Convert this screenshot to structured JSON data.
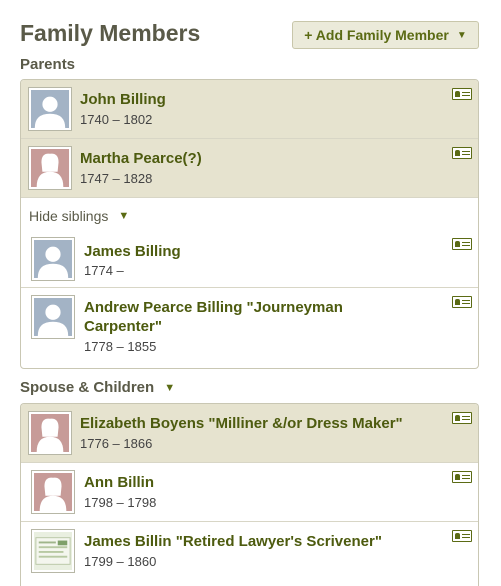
{
  "header": {
    "title": "Family Members",
    "add_button_label": "+ Add Family Member",
    "add_button_caret": "▼"
  },
  "parents_section": {
    "label": "Parents"
  },
  "parents": [
    {
      "name": "John Billing",
      "dates": "1740 – 1802",
      "avatar": "male-silhouette-icon"
    },
    {
      "name": "Martha Pearce(?)",
      "dates": "1747 – 1828",
      "avatar": "female-silhouette-icon"
    }
  ],
  "siblings_toggle": {
    "label": "Hide siblings",
    "caret": "▼"
  },
  "siblings": [
    {
      "name": "James Billing",
      "dates": "1774 –",
      "avatar": "male-silhouette-icon"
    },
    {
      "name_line1": "Andrew Pearce Billing \"Journeyman",
      "name_line2": "Carpenter\"",
      "dates": "1778 – 1855",
      "avatar": "male-silhouette-icon"
    }
  ],
  "spouse_section": {
    "label": "Spouse & Children",
    "caret": "▼"
  },
  "spouse": {
    "name": "Elizabeth Boyens \"Milliner &/or Dress Maker\"",
    "dates": "1776 – 1866",
    "avatar": "female-silhouette-icon"
  },
  "children": [
    {
      "name": "Ann Billin",
      "dates": "1798 – 1798",
      "avatar": "female-silhouette-icon"
    },
    {
      "name": "James Billin \"Retired Lawyer's Scrivener\"",
      "dates": "1799 – 1860",
      "avatar": "document-photo-icon"
    }
  ],
  "icons": {
    "card": "person-card-icon"
  },
  "colors": {
    "link_green": "#4d5b0f",
    "highlight": "#e6e3cf",
    "male_avatar": "#a3b3c5",
    "female_avatar": "#c79b98"
  }
}
